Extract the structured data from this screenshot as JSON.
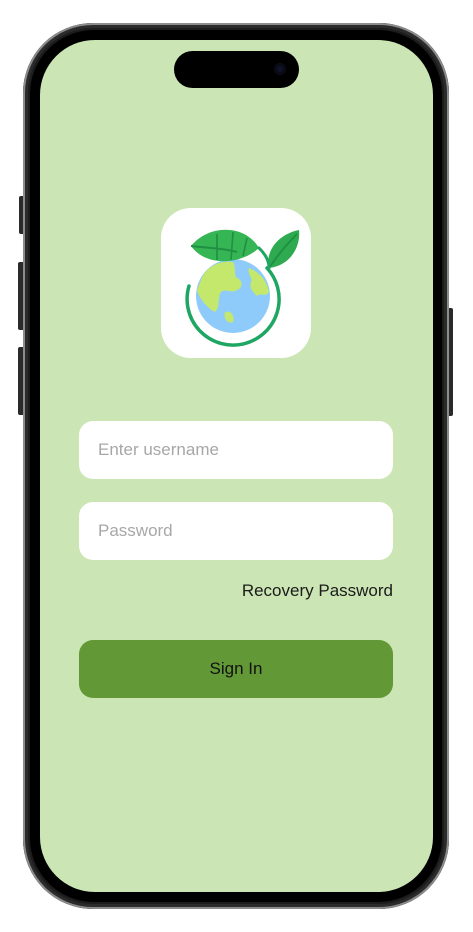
{
  "login": {
    "logo_icon": "earth-with-leaves-icon",
    "username": {
      "value": "",
      "placeholder": "Enter username"
    },
    "password": {
      "value": "",
      "placeholder": "Password"
    },
    "recovery_label": "Recovery Password",
    "signin_label": "Sign In"
  },
  "colors": {
    "screen_background": "#cbe6b4",
    "primary_button": "#639836",
    "input_background": "#ffffff"
  }
}
